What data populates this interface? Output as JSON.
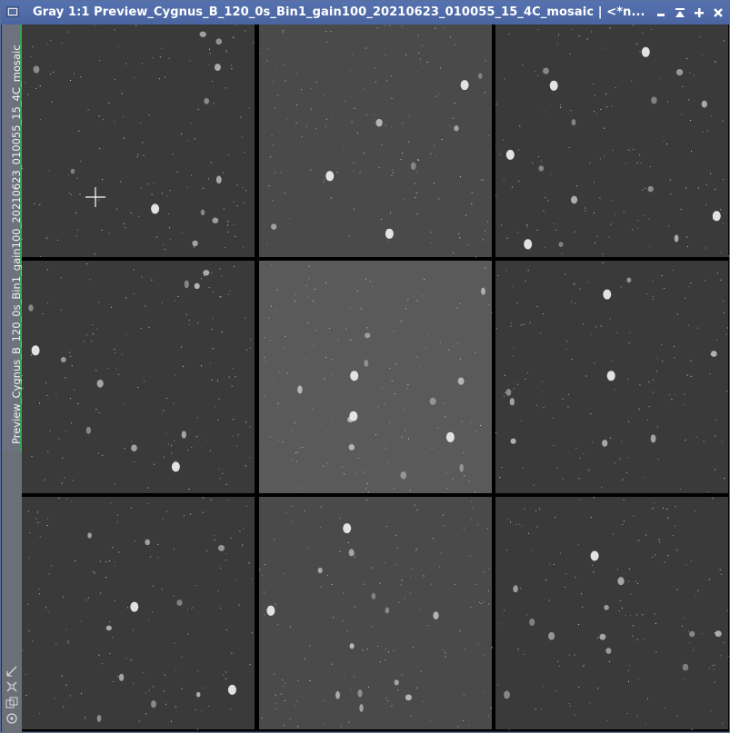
{
  "window": {
    "title": "Gray 1:1 Preview_Cygnus_B_120_0s_Bin1_gain100_20210623_010055_15_4C_mosaic | <*n..."
  },
  "sidebar": {
    "tab_label": "Preview_Cygnus_B_120_0s_Bin1_gain100_20210623_010055_15_4C_mosaic"
  },
  "colors": {
    "titlebar": "#4a64a0",
    "tab_indicator": "#3fa34d",
    "panel_bg_dark": "#3a3a3a",
    "panel_bg_mid": "#4a4a4a",
    "panel_bg_light": "#5a5a5a"
  },
  "icons": {
    "app": "app-icon",
    "minimize": "minimize-icon",
    "shade": "shade-icon",
    "maximize": "maximize-icon",
    "close": "close-icon"
  }
}
